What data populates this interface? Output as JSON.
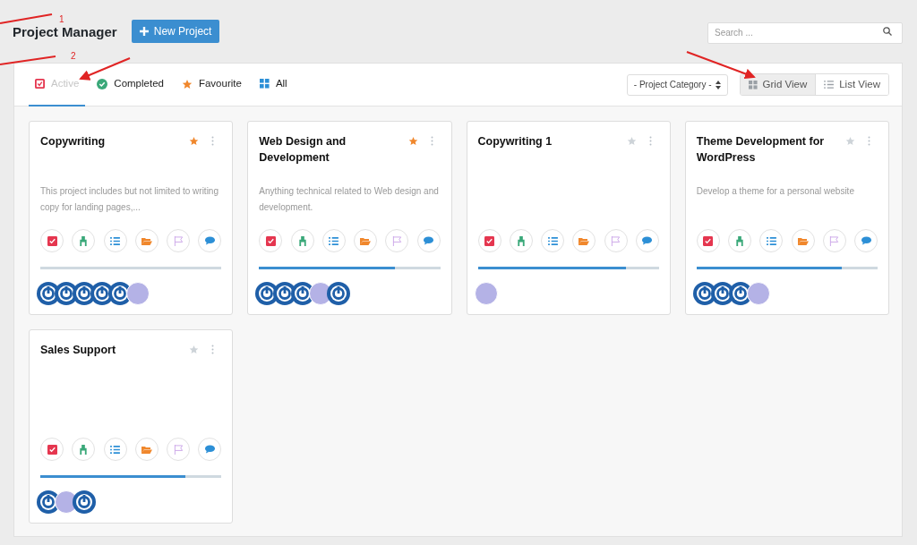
{
  "header": {
    "title": "Project Manager",
    "new_button": "New Project",
    "search": {
      "placeholder": "Search ..."
    }
  },
  "tabs": [
    {
      "label": "Active",
      "selected": true,
      "kind": "active"
    },
    {
      "label": "Completed",
      "selected": false,
      "kind": "completed"
    },
    {
      "label": "Favourite",
      "selected": false,
      "kind": "favourite"
    },
    {
      "label": "All",
      "selected": false,
      "kind": "all"
    }
  ],
  "category_select": {
    "value": "- Project Category -"
  },
  "views": [
    {
      "label": "Grid View",
      "selected": true,
      "kind": "grid"
    },
    {
      "label": "List View",
      "selected": false,
      "kind": "list"
    }
  ],
  "projects": [
    {
      "title": "Copywriting",
      "favourite": true,
      "description": "This project includes but not limited to writing copy for landing pages,...",
      "level": 0,
      "avatars": [
        {
          "kind": "logo"
        },
        {
          "kind": "logo"
        },
        {
          "kind": "logo"
        },
        {
          "kind": "logo"
        },
        {
          "kind": "logo"
        },
        {
          "kind": "photo"
        }
      ]
    },
    {
      "title": "Web Design and Development",
      "favourite": true,
      "description": "Anything technical related to Web design and development.",
      "level": 0.75,
      "avatars": [
        {
          "kind": "logo"
        },
        {
          "kind": "logo"
        },
        {
          "kind": "logo"
        },
        {
          "kind": "photo"
        },
        {
          "kind": "logo"
        }
      ]
    },
    {
      "title": "Copywriting 1",
      "favourite": false,
      "level": 0.82,
      "avatars": [
        {
          "kind": "photo"
        }
      ]
    },
    {
      "title": "Theme Development for WordPress",
      "favourite": false,
      "description": "Develop a theme for a personal website",
      "level": 0.8,
      "avatars": [
        {
          "kind": "logo"
        },
        {
          "kind": "logo"
        },
        {
          "kind": "logo"
        },
        {
          "kind": "photo"
        }
      ]
    },
    {
      "title": "Sales Support",
      "favourite": false,
      "level": 0.8,
      "avatars": [
        {
          "kind": "logo"
        },
        {
          "kind": "photo"
        },
        {
          "kind": "logo"
        }
      ]
    }
  ],
  "annotations": [
    {
      "label": "1"
    },
    {
      "label": "2"
    }
  ]
}
